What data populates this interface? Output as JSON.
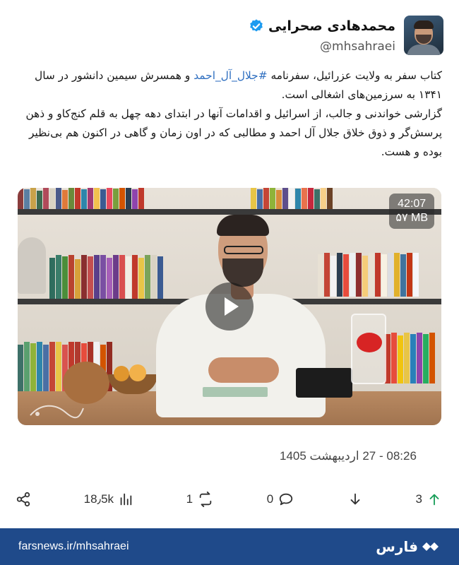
{
  "author": {
    "name": "محمدهادی صحرایی",
    "handle": "@mhsahraei",
    "verified": true
  },
  "post": {
    "line1_before": "کتاب سفر به ولایت عزرائیل، سفرنامه ",
    "hashtag": "#جلال_آل_احمد",
    "line1_after": " و همسرش سیمین دانشور در سال ۱۳۴۱ به سرزمین‌های اشغالی است.",
    "paragraph2": "گزارشی خواندنی و جالب، از اسرائیل و اقدامات آنها در ابتدای دهه چهل به قلم کنج‌کاو و ذهن پرسش‌گر و ذوق خلاق جلال آل احمد و مطالبی که در اون زمان و گاهی در اکنون هم بی‌نظیر بوده و هست."
  },
  "video": {
    "duration": "42:07",
    "size": "۵۷ MB"
  },
  "timestamp": "08:26 - 27 اردیبهشت 1405",
  "actions": {
    "share_icon": "share-icon",
    "views": "18٫5k",
    "retweets": "1",
    "replies": "0",
    "downvote_icon": "arrow-down-icon",
    "upvotes": "3"
  },
  "footer": {
    "url": "farsnews.ir/mhsahraei",
    "brand": "فارس"
  },
  "colors": {
    "hashtag": "#2f6fc0",
    "footer_bg": "#1f4a8a",
    "verified": "#1d9bf0",
    "upvote": "#1a9f5a"
  }
}
